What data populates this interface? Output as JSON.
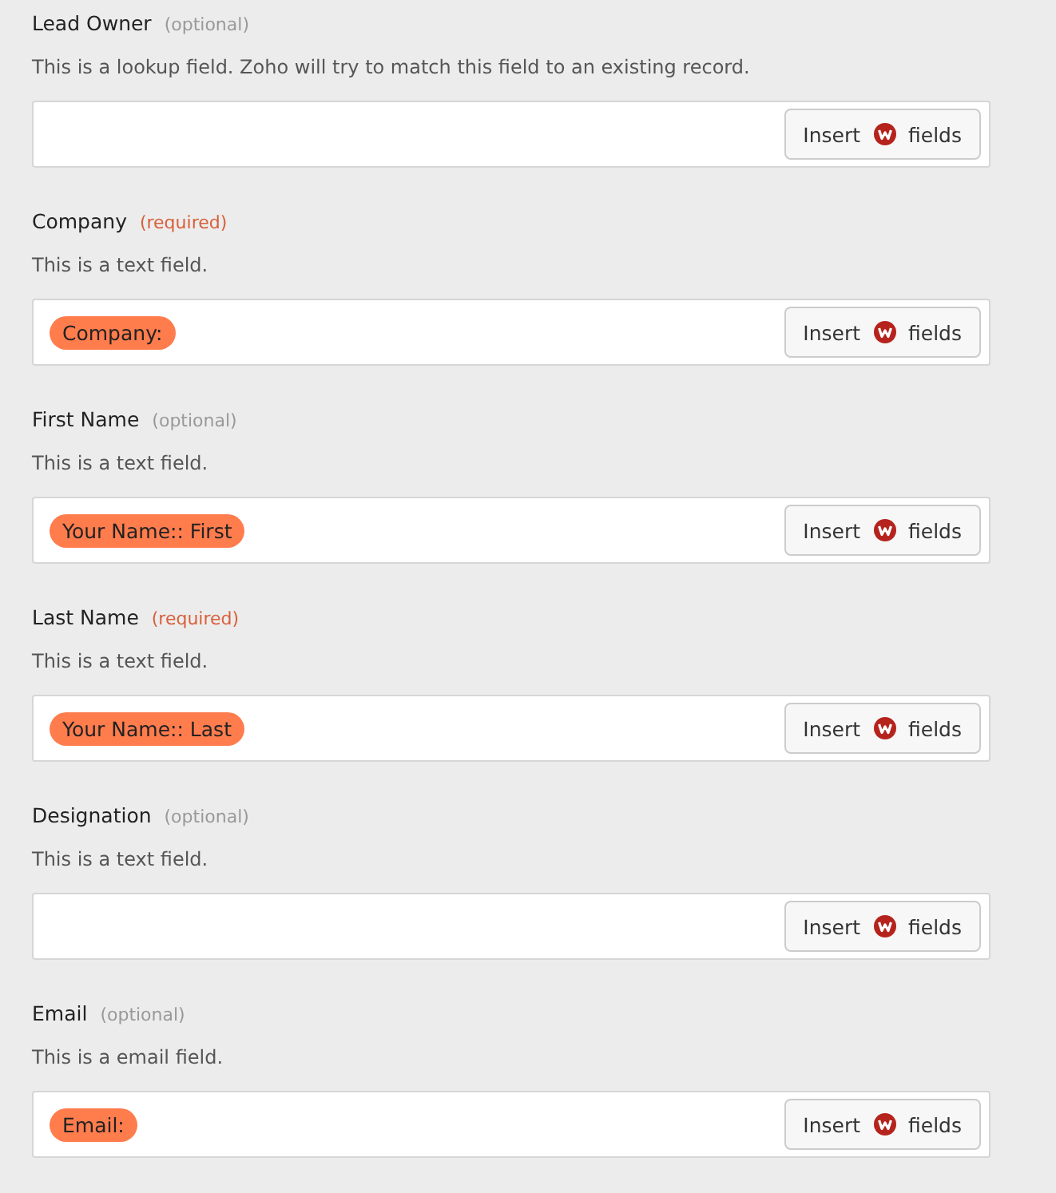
{
  "fields": [
    {
      "label": "Lead Owner",
      "note": "(optional)",
      "required": false,
      "description": "This is a lookup field. Zoho will try to match this field to an existing record.",
      "button": {
        "before": "Insert",
        "after": "fields"
      }
    },
    {
      "label": "Company",
      "note": "(required)",
      "required": true,
      "description": "This is a text field.",
      "tokens": [
        "Company:"
      ],
      "button": {
        "before": "Insert",
        "after": "fields"
      }
    },
    {
      "label": "First Name",
      "note": "(optional)",
      "required": false,
      "description": "This is a text field.",
      "tokens": [
        "Your Name:: First"
      ],
      "button": {
        "before": "Insert",
        "after": "fields"
      }
    },
    {
      "label": "Last Name",
      "note": "(required)",
      "required": true,
      "description": "This is a text field.",
      "tokens": [
        "Your Name:: Last"
      ],
      "button": {
        "before": "Insert",
        "after": "fields"
      }
    },
    {
      "label": "Designation",
      "note": "(optional)",
      "required": false,
      "description": "This is a text field.",
      "button": {
        "before": "Insert",
        "after": "fields"
      }
    },
    {
      "label": "Email",
      "note": "(optional)",
      "required": false,
      "description": "This is a email field.",
      "tokens": [
        "Email:"
      ],
      "button": {
        "before": "Insert",
        "after": "fields"
      }
    }
  ]
}
